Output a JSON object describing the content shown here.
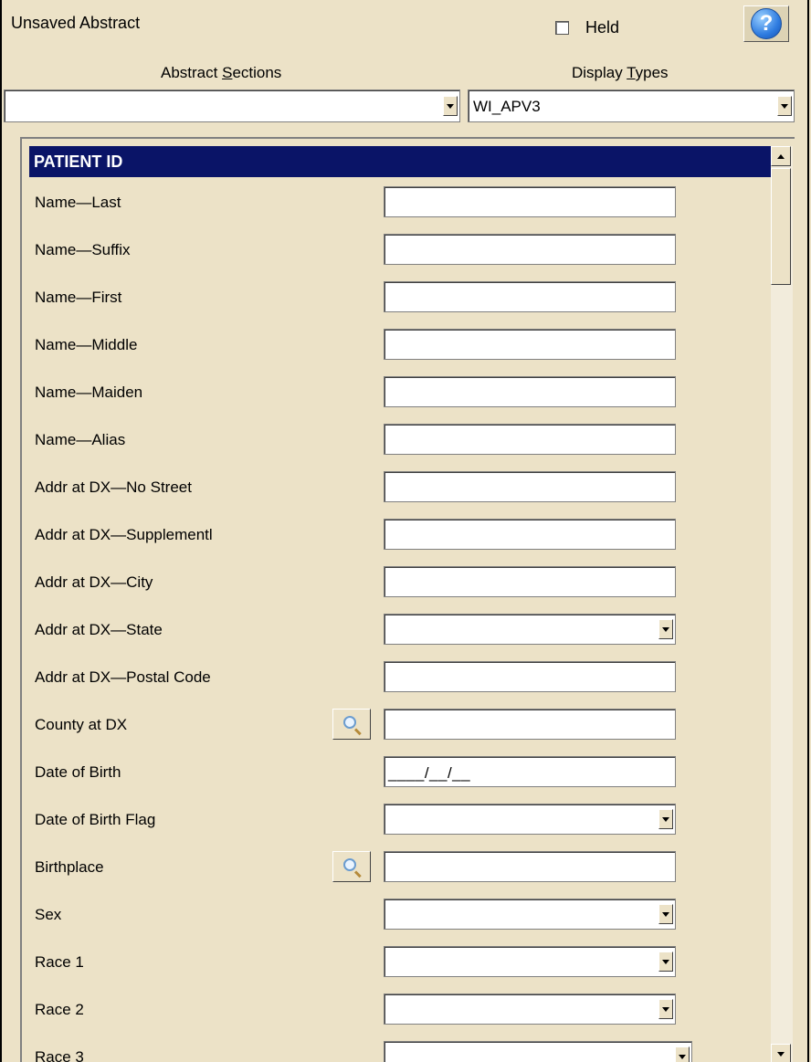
{
  "header": {
    "title": "Unsaved Abstract",
    "held_label": "Held",
    "help_symbol": "?"
  },
  "selectors": {
    "sections_label_pre": "Abstract ",
    "sections_label_key": "S",
    "sections_label_post": "ections",
    "sections_value": "",
    "display_label_pre": "Display ",
    "display_label_key": "T",
    "display_label_post": "ypes",
    "display_value": "WI_APV3"
  },
  "panel": {
    "section_title": "PATIENT ID",
    "fields": [
      {
        "label": "Name—Last",
        "type": "text",
        "value": ""
      },
      {
        "label": "Name—Suffix",
        "type": "text",
        "value": ""
      },
      {
        "label": "Name—First",
        "type": "text",
        "value": ""
      },
      {
        "label": "Name—Middle",
        "type": "text",
        "value": ""
      },
      {
        "label": "Name—Maiden",
        "type": "text",
        "value": ""
      },
      {
        "label": "Name—Alias",
        "type": "text",
        "value": ""
      },
      {
        "label": "Addr at DX—No Street",
        "type": "text",
        "value": ""
      },
      {
        "label": "Addr at DX—Supplementl",
        "type": "text",
        "value": ""
      },
      {
        "label": "Addr at DX—City",
        "type": "text",
        "value": ""
      },
      {
        "label": "Addr at DX—State",
        "type": "dropdown",
        "value": ""
      },
      {
        "label": "Addr at DX—Postal Code",
        "type": "text",
        "value": ""
      },
      {
        "label": "County at DX",
        "type": "lookup",
        "value": ""
      },
      {
        "label": "Date of Birth",
        "type": "date",
        "value": "____/__/__"
      },
      {
        "label": "Date of Birth Flag",
        "type": "dropdown",
        "value": ""
      },
      {
        "label": "Birthplace",
        "type": "lookup",
        "value": ""
      },
      {
        "label": "Sex",
        "type": "dropdown",
        "value": ""
      },
      {
        "label": "Race 1",
        "type": "dropdown",
        "value": ""
      },
      {
        "label": "Race 2",
        "type": "dropdown",
        "value": ""
      },
      {
        "label": "Race 3",
        "type": "dropdown",
        "value": ""
      }
    ]
  },
  "icons": {
    "help": "help-icon",
    "lookup": "magnifier-icon",
    "dropdown": "chevron-down-icon"
  },
  "colors": {
    "background": "#ece2c7",
    "section_header": "#0a1467"
  }
}
